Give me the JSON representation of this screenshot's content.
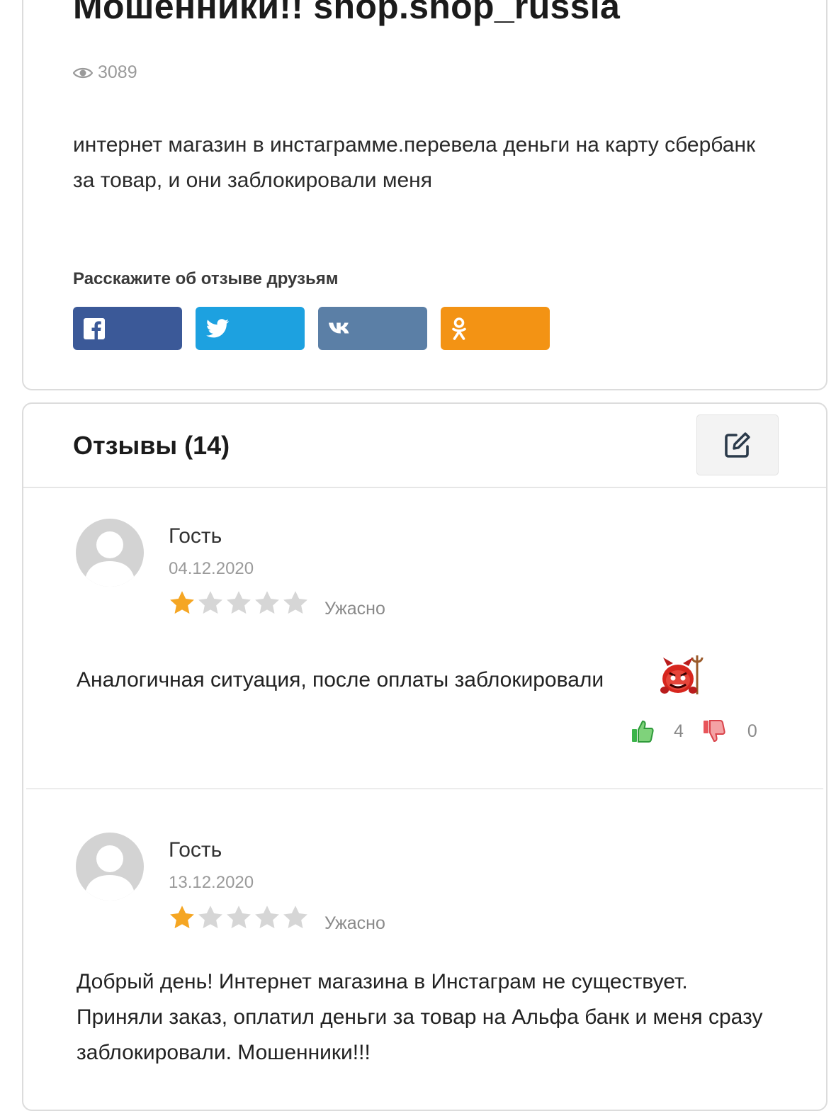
{
  "post": {
    "title": "Мошенники!! shop.shop_russia",
    "views": "3089",
    "description": "интернет магазин в инстаграмме.перевела деньги на карту сбербанк за товар, и они заблокировали меня"
  },
  "share": {
    "label": "Расскажите об отзыве друзьям",
    "buttons": [
      {
        "network": "facebook",
        "icon": "facebook-icon",
        "color": "#3b5998"
      },
      {
        "network": "twitter",
        "icon": "twitter-icon",
        "color": "#1da1e0"
      },
      {
        "network": "vk",
        "icon": "vk-icon",
        "color": "#5b7fa6"
      },
      {
        "network": "odnoklassniki",
        "icon": "odnoklassniki-icon",
        "color": "#f39314"
      }
    ]
  },
  "reviews": {
    "header": "Отзывы (14)",
    "edit_icon": "edit-icon",
    "items": [
      {
        "author": "Гость",
        "date": "04.12.2020",
        "rating": 1,
        "rating_max": 5,
        "rating_label": "Ужасно",
        "text": "Аналогичная ситуация, после оплаты заблокировали",
        "emoji": "devil-emoji",
        "likes": "4",
        "dislikes": "0"
      },
      {
        "author": "Гость",
        "date": "13.12.2020",
        "rating": 1,
        "rating_max": 5,
        "rating_label": "Ужасно",
        "text": "Добрый день! Интернет магазина в Инстаграм не существует. Приняли заказ, оплатил деньги за товар на Альфа банк и меня сразу заблокировали. Мошенники!!!"
      }
    ]
  },
  "colors": {
    "star_filled": "#f5a623",
    "star_empty": "#d6d6d6",
    "like": "#3bb44a",
    "dislike": "#e8555a"
  }
}
